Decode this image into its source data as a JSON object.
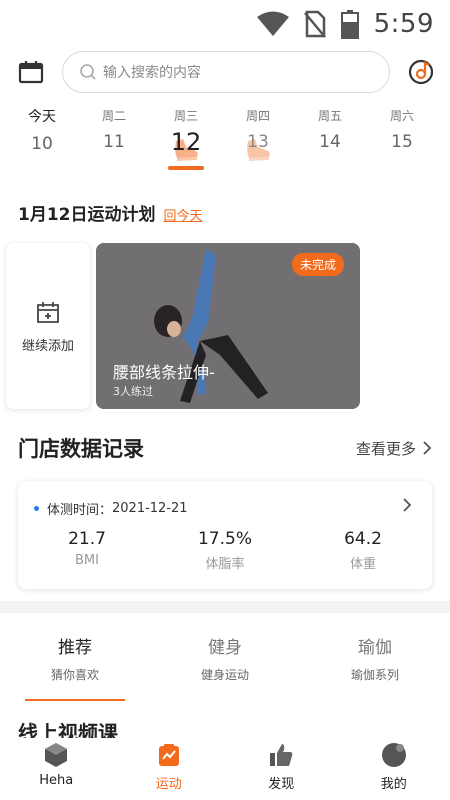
{
  "status_bar": {
    "time": "5:59"
  },
  "search": {
    "placeholder": "输入搜索的内容"
  },
  "week": [
    {
      "name": "今天",
      "num": "10"
    },
    {
      "name": "周二",
      "num": "11"
    },
    {
      "name": "周三",
      "num": "12"
    },
    {
      "name": "周四",
      "num": "13"
    },
    {
      "name": "周五",
      "num": "14"
    },
    {
      "name": "周六",
      "num": "15"
    }
  ],
  "plan": {
    "title": "1月12日运动计划",
    "back_today": "回今天",
    "add_label": "继续添加",
    "course": {
      "tag": "未完成",
      "title": "腰部线条拉伸-",
      "sub": "3人练过"
    }
  },
  "store": {
    "title": "门店数据记录",
    "more": "查看更多",
    "date_label": "体测时间：",
    "date": "2021-12-21",
    "metrics": [
      {
        "value": "21.7",
        "label": "BMI"
      },
      {
        "value": "17.5%",
        "label": "体脂率"
      },
      {
        "value": "64.2",
        "label": "体重"
      }
    ]
  },
  "tabs": [
    {
      "title": "推荐",
      "sub": "猜你喜欢"
    },
    {
      "title": "健身",
      "sub": "健身运动"
    },
    {
      "title": "瑜伽",
      "sub": "瑜伽系列"
    }
  ],
  "online_title": "线上视频课",
  "nav": [
    {
      "label": "Heha",
      "icon": "hexagon-icon"
    },
    {
      "label": "运动",
      "icon": "sport-icon"
    },
    {
      "label": "发现",
      "icon": "thumb-up-icon"
    },
    {
      "label": "我的",
      "icon": "user-icon"
    }
  ],
  "colors": {
    "accent": "#f26a1b",
    "dot": "#2a7de1"
  }
}
